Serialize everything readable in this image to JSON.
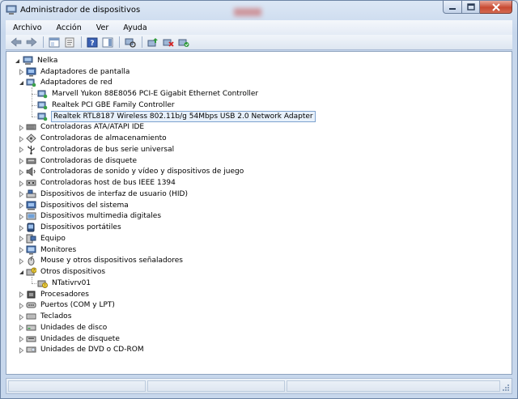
{
  "window": {
    "title": "Administrador de dispositivos"
  },
  "menu": [
    "Archivo",
    "Acción",
    "Ver",
    "Ayuda"
  ],
  "toolbar": [
    "back-arrow-icon",
    "forward-arrow-icon",
    "show-hide-console-tree-icon",
    "properties-icon",
    "help-icon",
    "action-pane-icon",
    "scan-hardware-icon",
    "update-driver-icon",
    "uninstall-icon",
    "enable-device-icon"
  ],
  "tree": {
    "root": "Nelka",
    "items": [
      {
        "label": "Adaptadores de pantalla",
        "level": 1,
        "expanded": false,
        "icon": "display-adapter-icon"
      },
      {
        "label": "Adaptadores de red",
        "level": 1,
        "expanded": true,
        "icon": "network-adapter-icon"
      },
      {
        "label": "Marvell Yukon 88E8056 PCI-E Gigabit Ethernet Controller",
        "level": 2,
        "icon": "network-card-icon"
      },
      {
        "label": "Realtek PCI GBE Family Controller",
        "level": 2,
        "icon": "network-card-icon"
      },
      {
        "label": "Realtek RTL8187 Wireless 802.11b/g 54Mbps USB 2.0 Network Adapter",
        "level": 2,
        "icon": "network-card-icon",
        "selected": true
      },
      {
        "label": "Controladoras ATA/ATAPI IDE",
        "level": 1,
        "expanded": false,
        "icon": "ide-controller-icon"
      },
      {
        "label": "Controladoras de almacenamiento",
        "level": 1,
        "expanded": false,
        "icon": "storage-controller-icon"
      },
      {
        "label": "Controladoras de bus serie universal",
        "level": 1,
        "expanded": false,
        "icon": "usb-icon"
      },
      {
        "label": "Controladoras de disquete",
        "level": 1,
        "expanded": false,
        "icon": "floppy-controller-icon"
      },
      {
        "label": "Controladoras de sonido y vídeo y dispositivos de juego",
        "level": 1,
        "expanded": false,
        "icon": "sound-icon"
      },
      {
        "label": "Controladoras host de bus IEEE 1394",
        "level": 1,
        "expanded": false,
        "icon": "ieee1394-icon"
      },
      {
        "label": "Dispositivos de interfaz de usuario (HID)",
        "level": 1,
        "expanded": false,
        "icon": "hid-icon"
      },
      {
        "label": "Dispositivos del sistema",
        "level": 1,
        "expanded": false,
        "icon": "system-device-icon"
      },
      {
        "label": "Dispositivos multimedia digitales",
        "level": 1,
        "expanded": false,
        "icon": "multimedia-icon"
      },
      {
        "label": "Dispositivos portátiles",
        "level": 1,
        "expanded": false,
        "icon": "portable-device-icon"
      },
      {
        "label": "Equipo",
        "level": 1,
        "expanded": false,
        "icon": "computer-icon"
      },
      {
        "label": "Monitores",
        "level": 1,
        "expanded": false,
        "icon": "monitor-icon"
      },
      {
        "label": "Mouse y otros dispositivos señaladores",
        "level": 1,
        "expanded": false,
        "icon": "mouse-icon"
      },
      {
        "label": "Otros dispositivos",
        "level": 1,
        "expanded": true,
        "icon": "other-devices-icon"
      },
      {
        "label": "NTativrv01",
        "level": 2,
        "icon": "unknown-device-icon"
      },
      {
        "label": "Procesadores",
        "level": 1,
        "expanded": false,
        "icon": "processor-icon"
      },
      {
        "label": "Puertos (COM y LPT)",
        "level": 1,
        "expanded": false,
        "icon": "port-icon"
      },
      {
        "label": "Teclados",
        "level": 1,
        "expanded": false,
        "icon": "keyboard-icon"
      },
      {
        "label": "Unidades de disco",
        "level": 1,
        "expanded": false,
        "icon": "disk-drive-icon"
      },
      {
        "label": "Unidades de disquete",
        "level": 1,
        "expanded": false,
        "icon": "floppy-drive-icon"
      },
      {
        "label": "Unidades de DVD o CD-ROM",
        "level": 1,
        "expanded": false,
        "icon": "dvd-drive-icon"
      }
    ]
  },
  "colors": {
    "selection_border": "#7da2ce",
    "selection_fill": "#e8f1fb",
    "close_button": "#c84a32"
  }
}
